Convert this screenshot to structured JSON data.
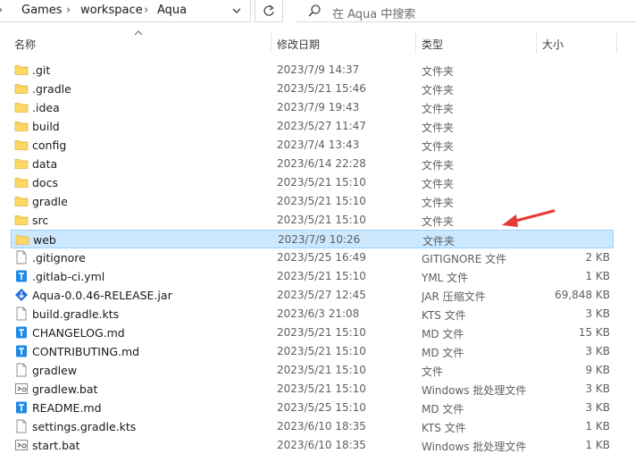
{
  "breadcrumb": [
    "Games",
    "workspace",
    "Aqua"
  ],
  "search_placeholder": "在 Aqua 中搜索",
  "columns": {
    "name": "名称",
    "date": "修改日期",
    "type": "类型",
    "size": "大小"
  },
  "files": [
    {
      "name": ".git",
      "date": "2023/7/9 14:37",
      "type": "文件夹",
      "size": "",
      "icon": "folder-icon"
    },
    {
      "name": ".gradle",
      "date": "2023/5/21 15:46",
      "type": "文件夹",
      "size": "",
      "icon": "folder-icon"
    },
    {
      "name": ".idea",
      "date": "2023/7/9 19:43",
      "type": "文件夹",
      "size": "",
      "icon": "folder-icon"
    },
    {
      "name": "build",
      "date": "2023/5/27 11:47",
      "type": "文件夹",
      "size": "",
      "icon": "folder-icon"
    },
    {
      "name": "config",
      "date": "2023/7/4 13:43",
      "type": "文件夹",
      "size": "",
      "icon": "folder-icon"
    },
    {
      "name": "data",
      "date": "2023/6/14 22:28",
      "type": "文件夹",
      "size": "",
      "icon": "folder-icon"
    },
    {
      "name": "docs",
      "date": "2023/5/21 15:10",
      "type": "文件夹",
      "size": "",
      "icon": "folder-icon"
    },
    {
      "name": "gradle",
      "date": "2023/5/21 15:10",
      "type": "文件夹",
      "size": "",
      "icon": "folder-icon"
    },
    {
      "name": "src",
      "date": "2023/5/21 15:10",
      "type": "文件夹",
      "size": "",
      "icon": "folder-icon"
    },
    {
      "name": "web",
      "date": "2023/7/9 10:26",
      "type": "文件夹",
      "size": "",
      "icon": "folder-icon",
      "selected": true
    },
    {
      "name": ".gitignore",
      "date": "2023/5/25 16:49",
      "type": "GITIGNORE 文件",
      "size": "2 KB",
      "icon": "file-icon"
    },
    {
      "name": ".gitlab-ci.yml",
      "date": "2023/5/21 15:10",
      "type": "YML 文件",
      "size": "1 KB",
      "icon": "text-file-icon"
    },
    {
      "name": "Aqua-0.0.46-RELEASE.jar",
      "date": "2023/5/27 12:45",
      "type": "JAR 压缩文件",
      "size": "69,848 KB",
      "icon": "jar-icon"
    },
    {
      "name": "build.gradle.kts",
      "date": "2023/6/3 21:08",
      "type": "KTS 文件",
      "size": "3 KB",
      "icon": "file-icon"
    },
    {
      "name": "CHANGELOG.md",
      "date": "2023/5/21 15:10",
      "type": "MD 文件",
      "size": "15 KB",
      "icon": "text-file-icon"
    },
    {
      "name": "CONTRIBUTING.md",
      "date": "2023/5/21 15:10",
      "type": "MD 文件",
      "size": "3 KB",
      "icon": "text-file-icon"
    },
    {
      "name": "gradlew",
      "date": "2023/5/21 15:10",
      "type": "文件",
      "size": "9 KB",
      "icon": "file-icon"
    },
    {
      "name": "gradlew.bat",
      "date": "2023/5/21 15:10",
      "type": "Windows 批处理文件",
      "size": "3 KB",
      "icon": "batch-icon"
    },
    {
      "name": "README.md",
      "date": "2023/5/25 15:10",
      "type": "MD 文件",
      "size": "3 KB",
      "icon": "text-file-icon"
    },
    {
      "name": "settings.gradle.kts",
      "date": "2023/6/10 18:35",
      "type": "KTS 文件",
      "size": "1 KB",
      "icon": "file-icon"
    },
    {
      "name": "start.bat",
      "date": "2023/6/10 18:35",
      "type": "Windows 批处理文件",
      "size": "1 KB",
      "icon": "batch-icon"
    }
  ],
  "colors": {
    "selection": "#cce8ff",
    "selection_border": "#99d1ff",
    "folder": "#ffd866",
    "accent": "#1e88e5",
    "annotation_arrow": "#e53935"
  }
}
